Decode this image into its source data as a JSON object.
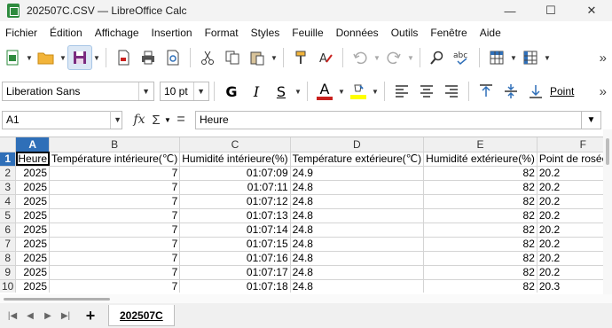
{
  "window": {
    "title": "202507C.CSV — LibreOffice Calc",
    "app_color": "#2e8b3e",
    "buttons": [
      "—",
      "☐",
      "✕"
    ]
  },
  "menu": [
    "Fichier",
    "Édition",
    "Affichage",
    "Insertion",
    "Format",
    "Styles",
    "Feuille",
    "Données",
    "Outils",
    "Fenêtre",
    "Aide"
  ],
  "toolbar_formatting": {
    "font_name": "Liberation Sans",
    "font_size": "10 pt",
    "bold": "G",
    "italic": "I",
    "underline": "S",
    "font_color_letter": "A",
    "font_color": "#c9211e",
    "highlight_color": "#ffff00"
  },
  "formula_bar": {
    "cell_ref": "A1",
    "fx": "fx",
    "sigma": "Σ",
    "equals": "=",
    "content": "Heure"
  },
  "sheet": {
    "columns": [
      "A",
      "B",
      "C",
      "D",
      "E",
      "F"
    ],
    "selected_column": "A",
    "selected_row": "1",
    "rows": [
      {
        "n": "1",
        "cells": [
          "Heure",
          "Température intérieure(℃)",
          "Humidité intérieure(%)",
          "Température extérieure(℃)",
          "Humidité extérieure(%)",
          "Point de rosée(℃)"
        ]
      },
      {
        "n": "2",
        "cells": [
          "2025",
          "7",
          "01:07:09",
          "24.9",
          "82",
          "20.2"
        ]
      },
      {
        "n": "3",
        "cells": [
          "2025",
          "7",
          "01:07:11",
          "24.8",
          "82",
          "20.2"
        ]
      },
      {
        "n": "4",
        "cells": [
          "2025",
          "7",
          "01:07:12",
          "24.8",
          "82",
          "20.2"
        ]
      },
      {
        "n": "5",
        "cells": [
          "2025",
          "7",
          "01:07:13",
          "24.8",
          "82",
          "20.2"
        ]
      },
      {
        "n": "6",
        "cells": [
          "2025",
          "7",
          "01:07:14",
          "24.8",
          "82",
          "20.2"
        ]
      },
      {
        "n": "7",
        "cells": [
          "2025",
          "7",
          "01:07:15",
          "24.8",
          "82",
          "20.2"
        ]
      },
      {
        "n": "8",
        "cells": [
          "2025",
          "7",
          "01:07:16",
          "24.8",
          "82",
          "20.2"
        ]
      },
      {
        "n": "9",
        "cells": [
          "2025",
          "7",
          "01:07:17",
          "24.8",
          "82",
          "20.2"
        ]
      },
      {
        "n": "10",
        "cells": [
          "2025",
          "7",
          "01:07:18",
          "24.8",
          "82",
          "20.3"
        ]
      }
    ]
  },
  "tabs": {
    "add": "+",
    "sheets": [
      "202507C"
    ]
  },
  "accent_color": "#2f6fb8"
}
